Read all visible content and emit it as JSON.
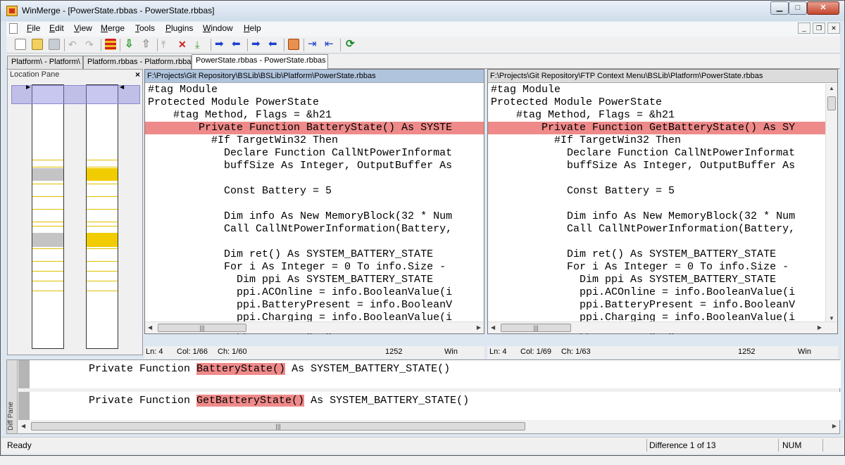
{
  "window": {
    "title": "WinMerge - [PowerState.rbbas - PowerState.rbbas]"
  },
  "menu": [
    "File",
    "Edit",
    "View",
    "Merge",
    "Tools",
    "Plugins",
    "Window",
    "Help"
  ],
  "toolbar_icons": [
    "new-icon",
    "open-icon",
    "save-icon",
    "undo-icon",
    "redo-icon",
    "options-icon",
    "next-diff-icon",
    "prev-diff-icon",
    "first-diff-icon",
    "current-diff-icon",
    "last-diff-icon",
    "copy-right-icon",
    "copy-left-icon",
    "copy-right-advance-icon",
    "copy-left-advance-icon",
    "all-right-icon",
    "all-left-icon",
    "refresh-icon"
  ],
  "tabs": [
    "Platform\\ - Platform\\",
    "Platform.rbbas - Platform.rbbas",
    "PowerState.rbbas - PowerState.rbbas"
  ],
  "location_pane": {
    "title": "Location Pane",
    "close": "×"
  },
  "left": {
    "path": "F:\\Projects\\Git Repository\\BSLib\\BSLib\\Platform\\PowerState.rbbas",
    "lines": [
      "#tag Module",
      "Protected Module PowerState",
      "    #tag Method, Flags = &h21",
      "        Private Function BatteryState() As SYSTE",
      "          #If TargetWin32 Then",
      "            Declare Function CallNtPowerInformat",
      "            buffSize As Integer, OutputBuffer As",
      "",
      "            Const Battery = 5",
      "",
      "            Dim info As New MemoryBlock(32 * Num",
      "            Call CallNtPowerInformation(Battery,",
      "",
      "            Dim ret() As SYSTEM_BATTERY_STATE",
      "            For i As Integer = 0 To info.Size -",
      "              Dim ppi As SYSTEM_BATTERY_STATE",
      "              ppi.ACOnline = info.BooleanValue(i",
      "              ppi.BatteryPresent = info.BooleanV",
      "              ppi.Charging = info.BooleanValue(i",
      "              ppi.Discharging = info.BooleanValu"
    ],
    "status": {
      "ln": "Ln: 4",
      "col": "Col: 1/66",
      "ch": "Ch: 1/60",
      "codepage": "1252",
      "eol": "Win"
    }
  },
  "right": {
    "path": "F:\\Projects\\Git Repository\\FTP Context Menu\\BSLib\\Platform\\PowerState.rbbas",
    "lines": [
      "#tag Module",
      "Protected Module PowerState",
      "    #tag Method, Flags = &h21",
      "        Private Function GetBatteryState() As SY",
      "          #If TargetWin32 Then",
      "            Declare Function CallNtPowerInformat",
      "            buffSize As Integer, OutputBuffer As",
      "",
      "            Const Battery = 5",
      "",
      "            Dim info As New MemoryBlock(32 * Num",
      "            Call CallNtPowerInformation(Battery,",
      "",
      "            Dim ret() As SYSTEM_BATTERY_STATE",
      "            For i As Integer = 0 To info.Size -",
      "              Dim ppi As SYSTEM_BATTERY_STATE",
      "              ppi.ACOnline = info.BooleanValue(i",
      "              ppi.BatteryPresent = info.BooleanV",
      "              ppi.Charging = info.BooleanValue(i",
      "              ppi.Discharging = info.BooleanValu"
    ],
    "status": {
      "ln": "Ln: 4",
      "col": "Col: 1/69",
      "ch": "Ch: 1/63",
      "codepage": "1252",
      "eol": "Win"
    }
  },
  "diff_pane": {
    "title": "Diff Pane",
    "left": {
      "pre": "Private Function ",
      "hl": "BatteryState()",
      "post": " As SYSTEM_BATTERY_STATE()"
    },
    "right": {
      "pre": "Private Function ",
      "hl": "GetBatteryState()",
      "post": " As SYSTEM_BATTERY_STATE()"
    }
  },
  "statusbar": {
    "ready": "Ready",
    "difference": "Difference 1 of 13",
    "num": "NUM"
  },
  "colors": {
    "diff_line": "#ef8a8a",
    "diff_word": "#f7b0b0",
    "moved": "#f0cc00",
    "location_view": "#8a8ad0"
  }
}
